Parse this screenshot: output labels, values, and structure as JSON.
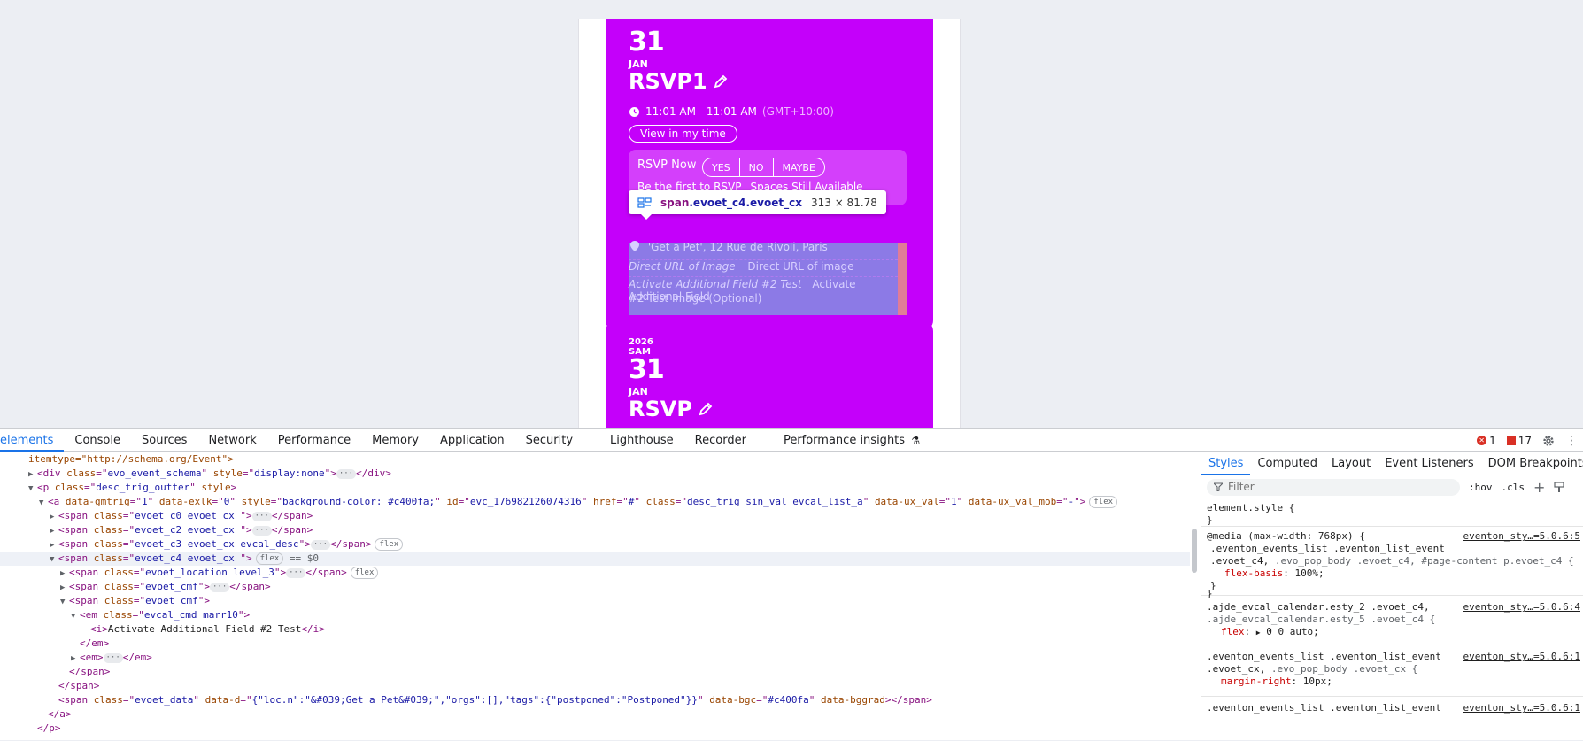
{
  "page_preview": {
    "card1": {
      "day": "31",
      "month": "JAN",
      "title": "RSVP1",
      "time": "11:01 AM - 11:01 AM",
      "timezone": "(GMT+10:00)",
      "view_button": "View in my time",
      "rsvp_label": "RSVP Now",
      "rsvp_options": [
        "YES",
        "NO",
        "MAYBE"
      ],
      "rsvp_first": "Be the first to RSVP",
      "rsvp_spaces": "Spaces Still Available",
      "location": "'Get a Pet', 12 Rue de Rivoli, Paris",
      "field1_label": "Direct URL of Image",
      "field1_value": "Direct URL of image",
      "field2_label": "Activate Additional Field #2 Test",
      "field2_value_a": "Activate Additional Field",
      "field2_value_b": "#2 Test Image (Optional)"
    },
    "card2": {
      "year": "2026",
      "weekday": "SAM",
      "day": "31",
      "month": "JAN",
      "title": "RSVP"
    },
    "card_color": "#c400fa",
    "tooltip": {
      "tag": "span",
      "classes": ".evoet_c4.evoet_cx",
      "dimensions": "313 × 81.78"
    }
  },
  "devtools": {
    "tabs": [
      "elements",
      "Console",
      "Sources",
      "Network",
      "Performance",
      "Memory",
      "Application",
      "Security",
      "Lighthouse",
      "Recorder",
      "Performance insights"
    ],
    "active_tab": "elements",
    "error_count": "1",
    "warning_count": "17",
    "dom": {
      "l0_text": "itemtype=\"http://schema.org/Event\">",
      "l1_attr_class": "evo_event_schema",
      "l1_attr_style": "display:none",
      "l2_class": "desc_trig_outter",
      "l3_gmtrig": "1",
      "l3_exlk": "0",
      "l3_style": "background-color: #c400fa;",
      "l3_id": "evc_176982126074316",
      "l3_href": "#",
      "l3_class": "desc_trig sin_val evcal_list_a",
      "l3_uxval": "1",
      "l3_uxmob": "-",
      "l4_class": "evoet_c0 evoet_cx ",
      "l5_class": "evoet_c2 evoet_cx ",
      "l6_class": "evoet_c3 evoet_cx evcal_desc",
      "l7_class": "evoet_c4 evoet_cx ",
      "l8_class": "evoet_location level_3",
      "l9_class": "evoet_cmf",
      "l10_class": "evoet_cmf",
      "l11_class": "evcal_cmd marr10",
      "l12_text": "Activate Additional Field #2 Test",
      "l16_class": "evoet_data",
      "l16_d": "{\"loc.n\":\"&#039;Get a Pet&#039;\",\"orgs\":[],\"tags\":{\"postponed\":\"Postponed\"}}",
      "l16_bgc": "#c400fa",
      "badge_flex": "flex",
      "selected_marker": "== $0"
    },
    "styles": {
      "tabs": [
        "Styles",
        "Computed",
        "Layout",
        "Event Listeners",
        "DOM Breakpoints"
      ],
      "active_tab": "Styles",
      "filter_placeholder": "Filter",
      "hov": ":hov",
      "cls": ".cls",
      "rule0_selector": "element.style {",
      "rule1_media": "@media (max-width: 768px) {",
      "rule1_sel_a": ".eventon_events_list .eventon_list_event",
      "rule1_sel_b": ".evoet_c4,",
      "rule1_sel_b_dim": " .evo_pop_body .evoet_c4, #page-content p.evoet_c4 {",
      "rule1_prop": "flex-basis",
      "rule1_val": "100%;",
      "rule1_src": "eventon_sty…=5.0.6:5",
      "rule2_sel_a": ".ajde_evcal_calendar.esty_2 .evoet_c4,",
      "rule2_sel_b": ".ajde_evcal_calendar.esty_5 .evoet_c4 {",
      "rule2_prop": "flex",
      "rule2_val": "0 0 auto;",
      "rule2_src": "eventon_sty…=5.0.6:4",
      "rule3_sel_a": ".eventon_events_list .eventon_list_event",
      "rule3_sel_b": ".evoet_cx,",
      "rule3_sel_b_dim": " .evo_pop_body .evoet_cx {",
      "rule3_prop": "margin-right",
      "rule3_val": "10px;",
      "rule3_src": "eventon_sty…=5.0.6:1",
      "rule4_sel_a": ".eventon_events_list .eventon_list_event",
      "rule4_src": "eventon_sty…=5.0.6:1"
    }
  }
}
